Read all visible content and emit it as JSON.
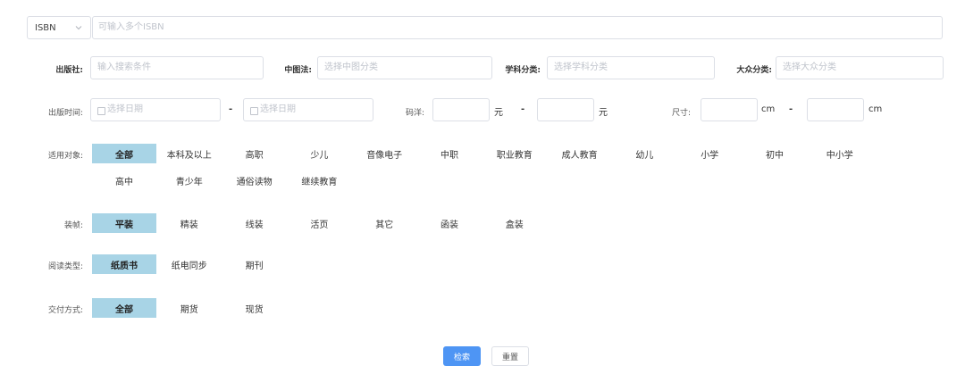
{
  "isbn": {
    "select_value": "ISBN",
    "placeholder": "可输入多个ISBN"
  },
  "publisher": {
    "label": "出版社:",
    "placeholder": "输入搜索条件"
  },
  "clc": {
    "label": "中图法:",
    "placeholder": "选择中图分类"
  },
  "subject": {
    "label": "学科分类:",
    "placeholder": "选择学科分类"
  },
  "popular": {
    "label": "大众分类:",
    "placeholder": "选择大众分类"
  },
  "pubdate": {
    "label": "出版时间:",
    "start_placeholder": "选择日期",
    "end_placeholder": "选择日期",
    "dash": "-"
  },
  "price": {
    "label": "码洋:",
    "unit": "元",
    "dash": "-"
  },
  "size": {
    "label": "尺寸:",
    "unit": "cm",
    "dash": "-"
  },
  "audience": {
    "label": "适用对象:",
    "options": [
      "全部",
      "本科及以上",
      "高职",
      "少儿",
      "音像电子",
      "中职",
      "职业教育",
      "成人教育",
      "幼儿",
      "小学",
      "初中",
      "中小学",
      "高中",
      "青少年",
      "通俗读物",
      "继续教育"
    ],
    "selected": "全部"
  },
  "binding": {
    "label": "装帧:",
    "options": [
      "平装",
      "精装",
      "线装",
      "活页",
      "其它",
      "函装",
      "盒装"
    ],
    "selected": "平装"
  },
  "reading": {
    "label": "阅读类型:",
    "options": [
      "纸质书",
      "纸电同步",
      "期刊"
    ],
    "selected": "纸质书"
  },
  "delivery": {
    "label": "交付方式:",
    "options": [
      "全部",
      "期货",
      "现货"
    ],
    "selected": "全部"
  },
  "buttons": {
    "search": "检索",
    "reset": "重置"
  }
}
